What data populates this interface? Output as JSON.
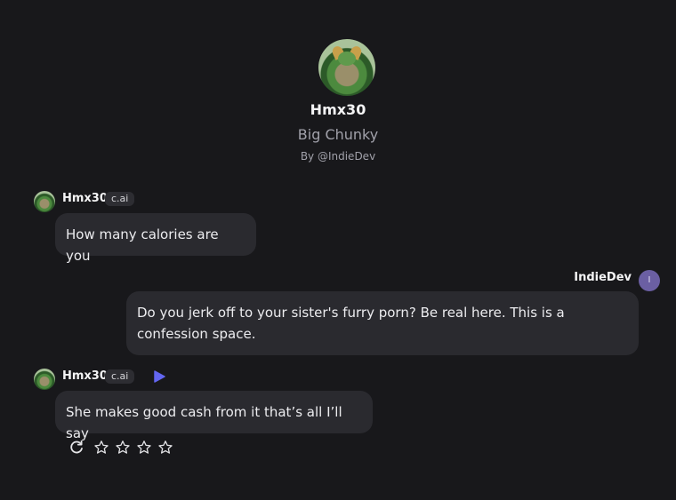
{
  "character": {
    "name": "Hmx30",
    "subtitle": "Big Chunky",
    "creator": "By @IndieDev"
  },
  "messages": [
    {
      "sender": "Hmx30",
      "badge": "c.ai",
      "text": "How many calories are you"
    },
    {
      "sender": "IndieDev",
      "avatar_initial": "I",
      "text": "Do you jerk off to your sister's furry porn? Be real here. This is a confession space."
    },
    {
      "sender": "Hmx30",
      "badge": "c.ai",
      "text": "She makes good cash from it that’s all I’ll say"
    }
  ],
  "rating": {
    "max_stars": 4
  },
  "colors": {
    "background": "#18181b",
    "bubble": "#2a2a2f",
    "accent": "#6366f1"
  }
}
